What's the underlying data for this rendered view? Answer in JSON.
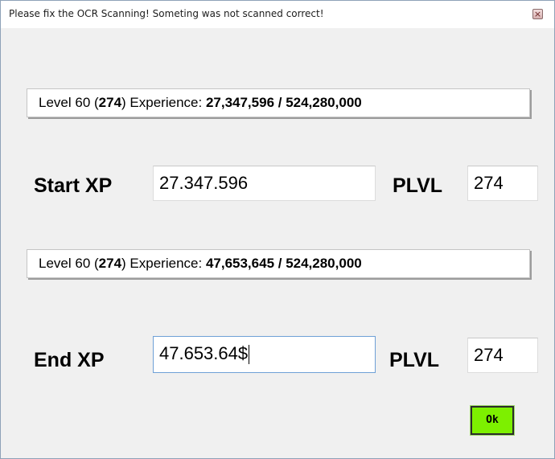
{
  "window": {
    "title": "Please fix the OCR Scanning! Someting was not scanned correct!",
    "close_symbol": "×"
  },
  "start": {
    "level_prefix": "Level 60 (",
    "level_plvl": "274",
    "level_mid": ") Experience: ",
    "level_xp": "27,347,596 / 524,280,000",
    "xp_label": "Start XP",
    "xp_value": "27.347.596",
    "plvl_label": "PLVL",
    "plvl_value": "274"
  },
  "end": {
    "level_prefix": "Level 60 (",
    "level_plvl": "274",
    "level_mid": ") Experience: ",
    "level_xp": "47,653,645 / 524,280,000",
    "xp_label": "End XP",
    "xp_value": "47.653.64$",
    "plvl_label": "PLVL",
    "plvl_value": "274"
  },
  "ok_label": "Ok",
  "colors": {
    "ok_button": "#7df000",
    "focus_border": "#6ea0d6"
  },
  "icons": {
    "close": "close-icon"
  }
}
